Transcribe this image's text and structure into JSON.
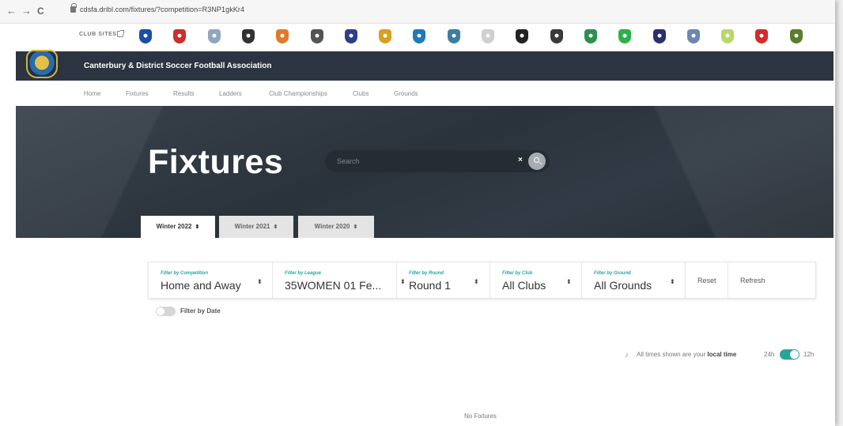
{
  "browser": {
    "back": "←",
    "forward": "→",
    "reload": "C",
    "url": "cdsfa.dribl.com/fixtures/?competition=R3NP1gkKr4"
  },
  "club_strip": {
    "label": "CLUB SITES",
    "crest_colors": [
      "#1c4fa1",
      "#c9302c",
      "#8fa6bd",
      "#333333",
      "#e07a2a",
      "#555555",
      "#2e3e8c",
      "#d9a020",
      "#1f7bb6",
      "#3f7d9c",
      "#cfcfcf",
      "#222222",
      "#3a3a3a",
      "#2f8f4f",
      "#2bb34a",
      "#2b2f6e",
      "#6f86b0",
      "#b8d86a",
      "#d32b2b",
      "#5b7d2e"
    ]
  },
  "association": {
    "name": "Canterbury & District Soccer Football Association"
  },
  "nav": {
    "items": [
      "Home",
      "Fixtures",
      "Results",
      "Ladders",
      "Club Championships",
      "Clubs",
      "Grounds"
    ]
  },
  "hero": {
    "title": "Fixtures",
    "search_placeholder": "Search",
    "clear": "×"
  },
  "seasons": [
    {
      "label": "Winter 2022",
      "active": true
    },
    {
      "label": "Winter 2021",
      "active": false
    },
    {
      "label": "Winter 2020",
      "active": false
    }
  ],
  "sort_glyph": "⬍",
  "filters": [
    {
      "label": "Filter by Competition",
      "value": "Home and Away"
    },
    {
      "label": "Filter by League",
      "value": "35WOMEN 01 Fe..."
    },
    {
      "label": "Filter by Round",
      "value": "Round 1"
    },
    {
      "label": "Filter by Club",
      "value": "All Clubs"
    },
    {
      "label": "Filter by Ground",
      "value": "All Grounds"
    }
  ],
  "actions": {
    "reset": "Reset",
    "refresh": "Refresh"
  },
  "date_filter": {
    "label": "Filter by Date",
    "enabled": false
  },
  "time_notice": {
    "icon": "♪",
    "prefix": "All times shown are your",
    "emphasis": "local time",
    "h24": "24h",
    "h12": "12h",
    "mode": "12h"
  },
  "empty_state": "No Fixtures",
  "colors": {
    "header_bg": "#2b3440",
    "accent": "#26a69a",
    "hero_bg": "#2f3841"
  }
}
